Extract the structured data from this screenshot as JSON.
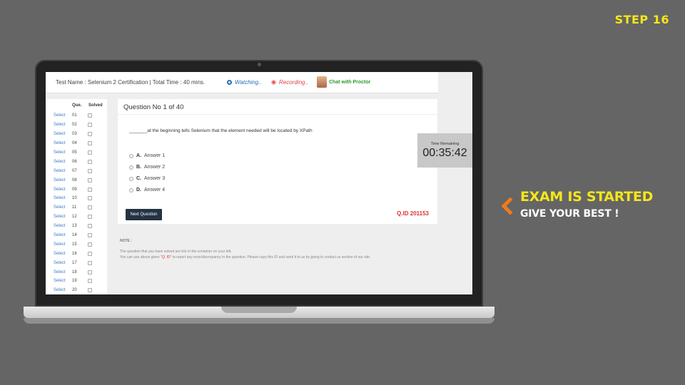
{
  "step_label": "STEP 16",
  "header": {
    "test_name": "Test Name : Selenium 2 Certification | Total Time : 40 mins.",
    "watching": "Watching..",
    "recording": "Recording..",
    "chat": "Chat with Proctor"
  },
  "question_list": {
    "col_que": "Que.",
    "col_solved": "Solved",
    "select_label": "Select",
    "items": [
      "01",
      "02",
      "03",
      "04",
      "05",
      "06",
      "07",
      "08",
      "09",
      "10",
      "11",
      "12",
      "13",
      "14",
      "15",
      "16",
      "17",
      "18",
      "19",
      "20"
    ]
  },
  "question": {
    "title": "Question No 1 of 40",
    "text": "_______at the beginning tells Selenium that the element needed will be located by XPath",
    "answers": [
      {
        "letter": "A.",
        "text": "Answer 1"
      },
      {
        "letter": "B.",
        "text": "Answer 2"
      },
      {
        "letter": "C.",
        "text": "Answer 3"
      },
      {
        "letter": "D.",
        "text": "Answer 4"
      }
    ],
    "next_button": "Next Question",
    "qid": "Q.ID 201153"
  },
  "timer": {
    "label": "Time Remaining",
    "value": "00:35:42"
  },
  "note": {
    "title": "NOTE :",
    "line1": "The question that you have solved are tick in the container on your left.",
    "line2_pre": "You can use above given \"",
    "line2_qid": "Q. ID",
    "line2_post": "\" to report any error/discrepancy in the question. Please copy this ID and send it to us by going to contact us section of our site."
  },
  "promo": {
    "line1": "EXAM IS STARTED",
    "line2": "GIVE YOUR BEST !"
  },
  "colors": {
    "background": "#656565",
    "accent_yellow": "#f5e61a",
    "arrow_orange": "#f07a1a",
    "qid_red": "#dd3333",
    "button_dark": "#243342"
  }
}
